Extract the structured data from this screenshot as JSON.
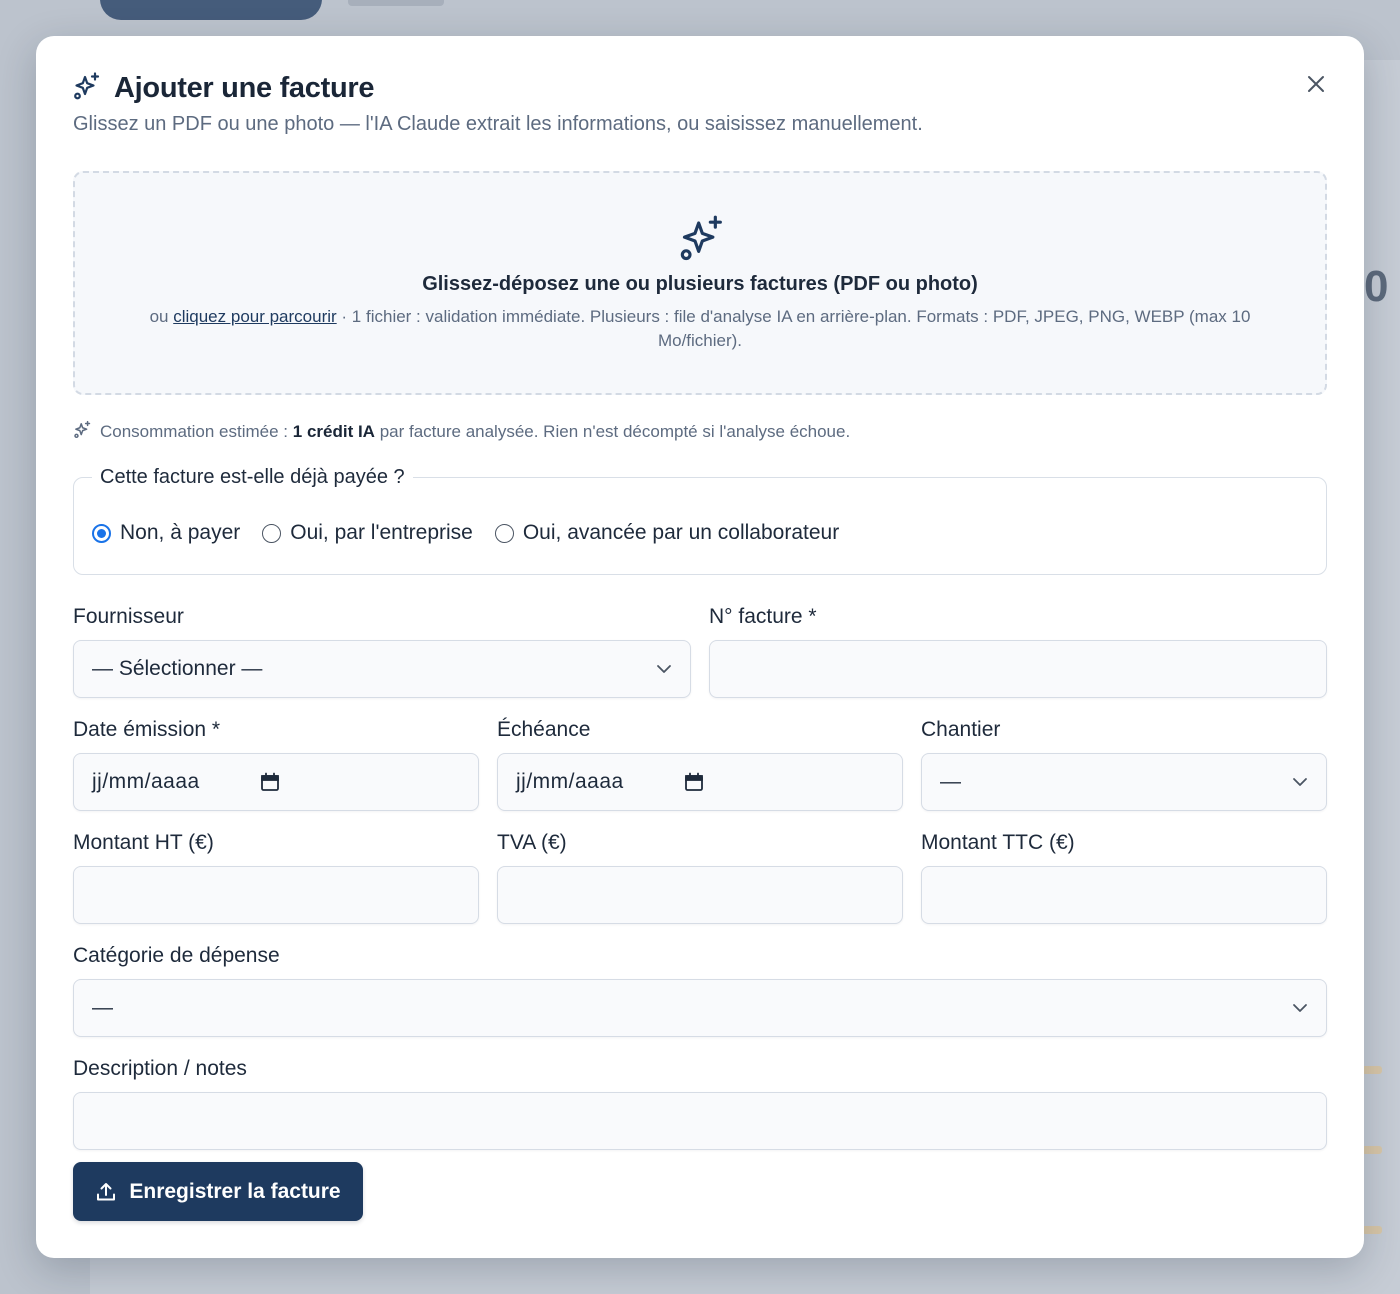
{
  "modal": {
    "title": "Ajouter une facture",
    "subtitle": "Glissez un PDF ou une photo — l'IA Claude extrait les informations, ou saisissez manuellement.",
    "close_icon": "close-icon"
  },
  "dropzone": {
    "title": "Glissez-déposez une ou plusieurs factures (PDF ou photo)",
    "hint_prefix": "ou",
    "browse_link": "cliquez pour parcourir",
    "hint_suffix": "· 1 fichier : validation immédiate. Plusieurs : file d'analyse IA en arrière-plan. Formats : PDF, JPEG, PNG, WEBP (max 10 Mo/fichier).",
    "icon": "sparkles-icon"
  },
  "credits": {
    "prefix": "Consommation estimée :",
    "amount": "1 crédit IA",
    "suffix": "par facture analysée. Rien n'est décompté si l'analyse échoue."
  },
  "payment": {
    "legend": "Cette facture est-elle déjà payée ?",
    "options": [
      {
        "label": "Non, à payer",
        "checked": true
      },
      {
        "label": "Oui, par l'entreprise",
        "checked": false
      },
      {
        "label": "Oui, avancée par un collaborateur",
        "checked": false
      }
    ]
  },
  "fields": {
    "supplier": {
      "label": "Fournisseur",
      "value": "— Sélectionner —"
    },
    "invoice_number": {
      "label": "N° facture *",
      "value": ""
    },
    "issue_date": {
      "label": "Date émission *",
      "placeholder": "jj/mm/aaaa"
    },
    "due_date": {
      "label": "Échéance",
      "placeholder": "jj/mm/aaaa"
    },
    "site": {
      "label": "Chantier",
      "value": "—"
    },
    "amount_ht": {
      "label": "Montant HT (€)",
      "value": ""
    },
    "vat": {
      "label": "TVA (€)",
      "value": ""
    },
    "amount_ttc": {
      "label": "Montant TTC (€)",
      "value": ""
    },
    "category": {
      "label": "Catégorie de dépense",
      "value": "—"
    },
    "description": {
      "label": "Description / notes",
      "value": ""
    }
  },
  "actions": {
    "save_label": "Enregistrer la facture"
  }
}
